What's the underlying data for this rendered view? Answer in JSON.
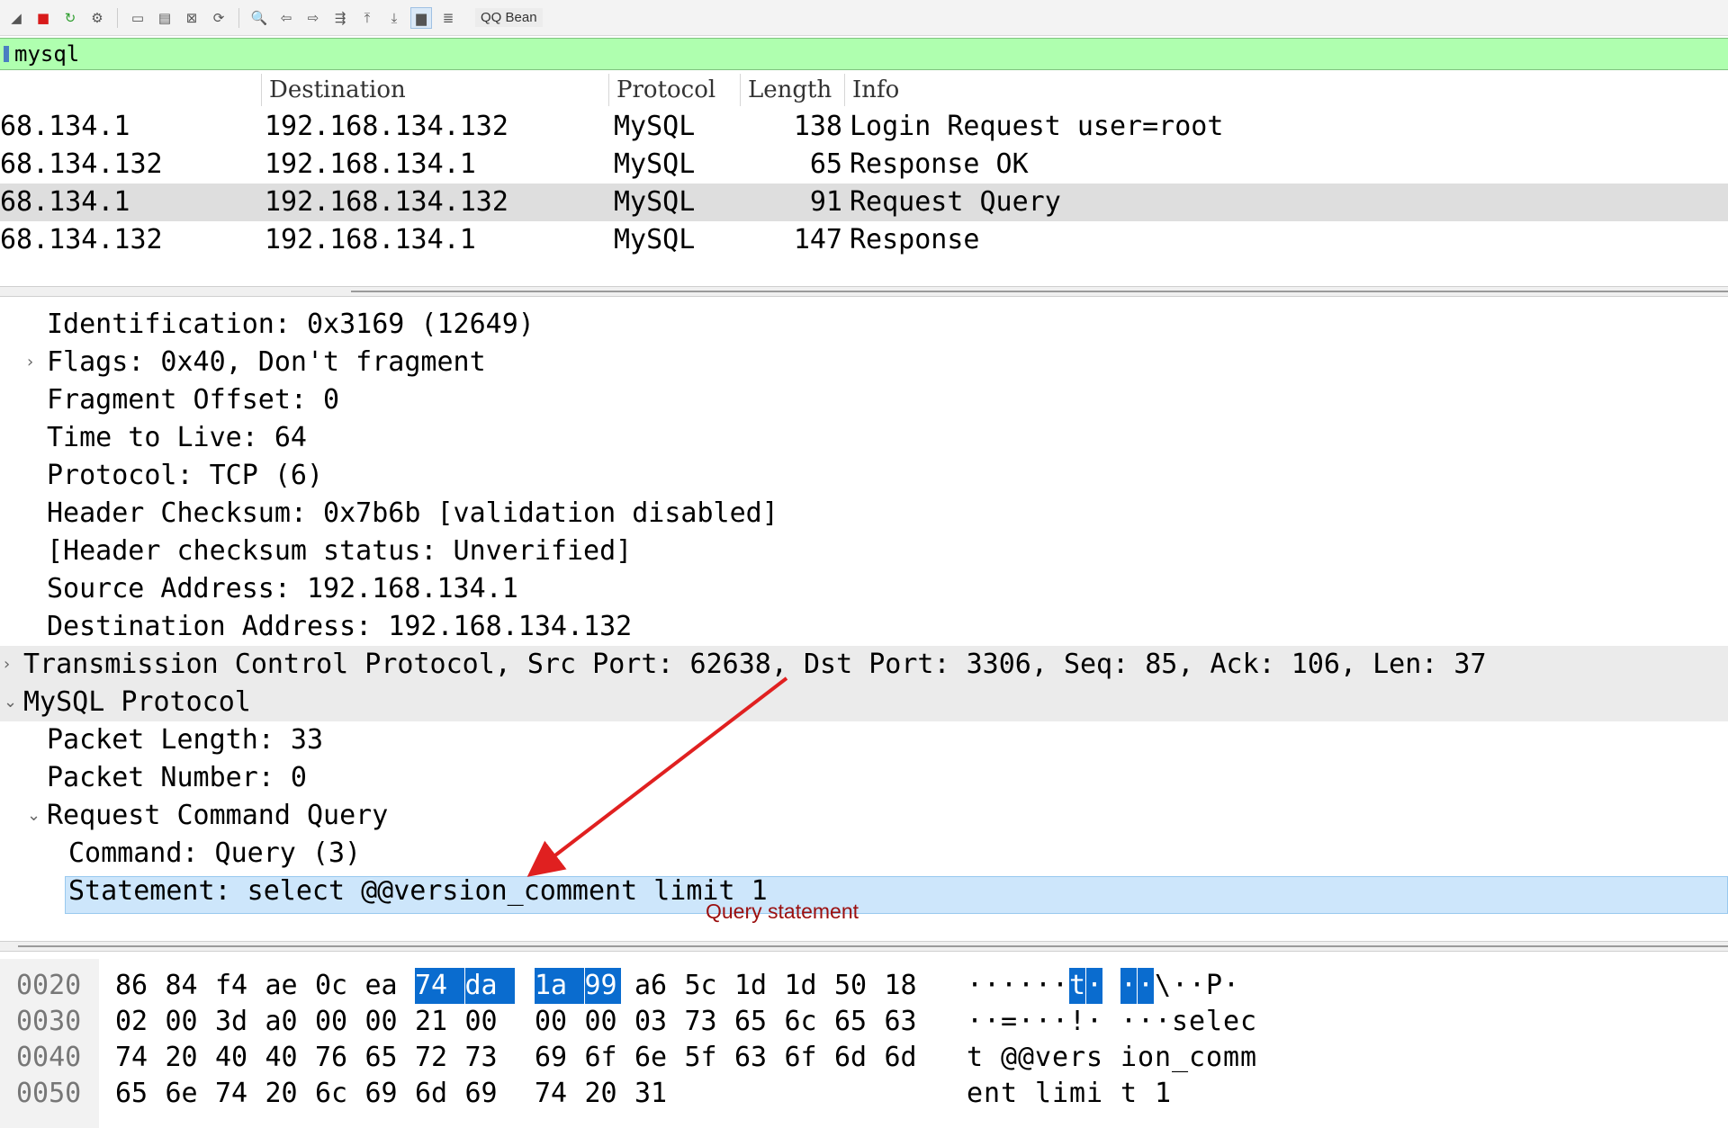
{
  "toolbar": {
    "icons": [
      "shark-fin-icon",
      "stop-icon",
      "restart-icon",
      "options-icon",
      "open-file-icon",
      "save-icon",
      "close-file-icon",
      "reload-icon",
      "find-icon",
      "back-icon",
      "forward-icon",
      "go-to-packet-icon",
      "first-packet-icon",
      "last-packet-icon",
      "autoscroll-icon",
      "colorize-icon"
    ],
    "label": "QQ Bean"
  },
  "filter": {
    "value": "mysql"
  },
  "packet_list": {
    "columns": [
      "Destination",
      "Protocol",
      "Length",
      "Info"
    ],
    "rows": [
      {
        "source": "68.134.1",
        "destination": "192.168.134.132",
        "protocol": "MySQL",
        "length": "138",
        "info": "Login Request user=root",
        "selected": false
      },
      {
        "source": "68.134.132",
        "destination": "192.168.134.1",
        "protocol": "MySQL",
        "length": "65",
        "info": "Response OK",
        "selected": false
      },
      {
        "source": "68.134.1",
        "destination": "192.168.134.132",
        "protocol": "MySQL",
        "length": "91",
        "info": "Request Query",
        "selected": true
      },
      {
        "source": "68.134.132",
        "destination": "192.168.134.1",
        "protocol": "MySQL",
        "length": "147",
        "info": "Response",
        "selected": false
      }
    ]
  },
  "details": {
    "lines": [
      {
        "text": "Identification: 0x3169 (12649)",
        "indent": 1,
        "arrow": "",
        "shaded": false
      },
      {
        "text": "Flags: 0x40, Don't fragment",
        "indent": 1,
        "arrow": "›",
        "shaded": false
      },
      {
        "text": "Fragment Offset: 0",
        "indent": 1,
        "arrow": "",
        "shaded": false
      },
      {
        "text": "Time to Live: 64",
        "indent": 1,
        "arrow": "",
        "shaded": false
      },
      {
        "text": "Protocol: TCP (6)",
        "indent": 1,
        "arrow": "",
        "shaded": false
      },
      {
        "text": "Header Checksum: 0x7b6b [validation disabled]",
        "indent": 1,
        "arrow": "",
        "shaded": false
      },
      {
        "text": "[Header checksum status: Unverified]",
        "indent": 1,
        "arrow": "",
        "shaded": false
      },
      {
        "text": "Source Address: 192.168.134.1",
        "indent": 1,
        "arrow": "",
        "shaded": false
      },
      {
        "text": "Destination Address: 192.168.134.132",
        "indent": 1,
        "arrow": "",
        "shaded": false
      },
      {
        "text": "Transmission Control Protocol, Src Port: 62638, Dst Port: 3306, Seq: 85, Ack: 106, Len: 37",
        "indent": 0,
        "arrow": "›",
        "shaded": true
      },
      {
        "text": "MySQL Protocol",
        "indent": 0,
        "arrow": "⌄",
        "shaded": true
      },
      {
        "text": "Packet Length: 33",
        "indent": 1,
        "arrow": "",
        "shaded": false
      },
      {
        "text": "Packet Number: 0",
        "indent": 1,
        "arrow": "",
        "shaded": false
      },
      {
        "text": "Request Command Query",
        "indent": 1,
        "arrow": "⌄",
        "shaded": false
      },
      {
        "text": "Command: Query (3)",
        "indent": 2,
        "arrow": "",
        "shaded": false
      },
      {
        "text": "Statement: select @@version_comment limit 1",
        "indent": 2,
        "arrow": "",
        "shaded": false
      }
    ],
    "annotation": "Query statement",
    "annotation_color": "#9b0f0f"
  },
  "hex": {
    "rows": [
      {
        "offset": "0020",
        "bytes": [
          "86",
          "84",
          "f4",
          "ae",
          "0c",
          "ea",
          "74",
          "da",
          "1a",
          "99",
          "a6",
          "5c",
          "1d",
          "1d",
          "50",
          "18"
        ],
        "ascii": [
          "·",
          "·",
          "·",
          "·",
          "·",
          "·",
          "t",
          "·",
          "·",
          "·",
          "\\",
          "·",
          "·",
          "P",
          "·",
          ""
        ],
        "hl": [
          6,
          7,
          8,
          9
        ]
      },
      {
        "offset": "0030",
        "bytes": [
          "02",
          "00",
          "3d",
          "a0",
          "00",
          "00",
          "21",
          "00",
          "00",
          "00",
          "03",
          "73",
          "65",
          "6c",
          "65",
          "63"
        ],
        "ascii": [
          "·",
          "·",
          "=",
          "·",
          "·",
          "·",
          "!",
          "·",
          "·",
          "·",
          "·",
          "s",
          "e",
          "l",
          "e",
          "c"
        ],
        "hl": []
      },
      {
        "offset": "0040",
        "bytes": [
          "74",
          "20",
          "40",
          "40",
          "76",
          "65",
          "72",
          "73",
          "69",
          "6f",
          "6e",
          "5f",
          "63",
          "6f",
          "6d",
          "6d"
        ],
        "ascii": [
          "t",
          " ",
          "@",
          "@",
          "v",
          "e",
          "r",
          "s",
          "i",
          "o",
          "n",
          "_",
          "c",
          "o",
          "m",
          "m"
        ],
        "hl": []
      },
      {
        "offset": "0050",
        "bytes": [
          "65",
          "6e",
          "74",
          "20",
          "6c",
          "69",
          "6d",
          "69",
          "74",
          "20",
          "31"
        ],
        "ascii": [
          "e",
          "n",
          "t",
          " ",
          "l",
          "i",
          "m",
          "i",
          "t",
          " ",
          "1"
        ],
        "hl": []
      }
    ],
    "highlight_color": "#0a6ccf"
  }
}
